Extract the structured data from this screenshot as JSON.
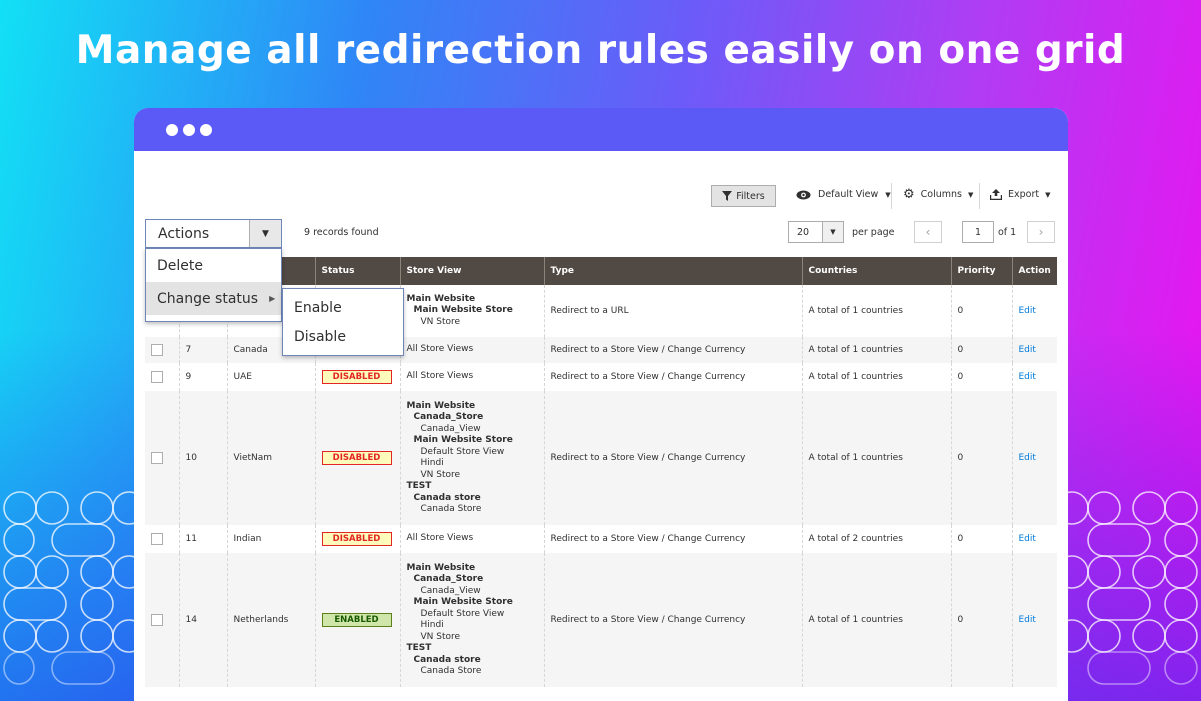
{
  "headline": "Manage all redirection rules easily on one grid",
  "colors": {
    "accent": "#5b5af6",
    "header_bg": "#514943",
    "link": "#007bdb",
    "disabled": "#e22626",
    "enabled": "#185b00"
  },
  "toolbar": {
    "filters_label": "Filters",
    "view_label": "Default View",
    "columns_label": "Columns",
    "export_label": "Export",
    "actions_label": "Actions",
    "records_found": "9 records found",
    "per_page_value": "20",
    "per_page_label": "per page",
    "page_value": "1",
    "page_of": "of 1"
  },
  "actions_menu": {
    "items": [
      "Delete",
      "Change status"
    ],
    "submenu": [
      "Enable",
      "Disable"
    ]
  },
  "grid": {
    "columns": [
      "Status",
      "Store View",
      "Type",
      "Countries",
      "Priority",
      "Action"
    ],
    "rows": [
      {
        "id": "",
        "name": "",
        "status": "",
        "store_view": [
          [
            "l0",
            "Main Website"
          ],
          [
            "l1",
            "Main Website Store"
          ],
          [
            "l2",
            "VN Store"
          ]
        ],
        "type": "Redirect to a URL",
        "countries": "A total of 1 countries",
        "priority": "0",
        "action": "Edit"
      },
      {
        "id": "7",
        "name": "Canada",
        "status": "",
        "store_view": [
          [
            "plain",
            "All Store Views"
          ]
        ],
        "type": "Redirect to a Store View / Change Currency",
        "countries": "A total of 1 countries",
        "priority": "0",
        "action": "Edit"
      },
      {
        "id": "9",
        "name": "UAE",
        "status": "DISABLED",
        "store_view": [
          [
            "plain",
            "All Store Views"
          ]
        ],
        "type": "Redirect to a Store View / Change Currency",
        "countries": "A total of 1 countries",
        "priority": "0",
        "action": "Edit"
      },
      {
        "id": "10",
        "name": "VietNam",
        "status": "DISABLED",
        "store_view": [
          [
            "l0",
            "Main Website"
          ],
          [
            "l1",
            "Canada_Store"
          ],
          [
            "l2",
            "Canada_View"
          ],
          [
            "l1",
            "Main Website Store"
          ],
          [
            "l2",
            "Default Store View"
          ],
          [
            "l2",
            "Hindi"
          ],
          [
            "l2",
            "VN Store"
          ],
          [
            "l0",
            "TEST"
          ],
          [
            "l1",
            "Canada store"
          ],
          [
            "l2",
            "Canada Store"
          ]
        ],
        "type": "Redirect to a Store View / Change Currency",
        "countries": "A total of 1 countries",
        "priority": "0",
        "action": "Edit"
      },
      {
        "id": "11",
        "name": "Indian",
        "status": "DISABLED",
        "store_view": [
          [
            "plain",
            "All Store Views"
          ]
        ],
        "type": "Redirect to a Store View / Change Currency",
        "countries": "A total of 2 countries",
        "priority": "0",
        "action": "Edit"
      },
      {
        "id": "14",
        "name": "Netherlands",
        "status": "ENABLED",
        "store_view": [
          [
            "l0",
            "Main Website"
          ],
          [
            "l1",
            "Canada_Store"
          ],
          [
            "l2",
            "Canada_View"
          ],
          [
            "l1",
            "Main Website Store"
          ],
          [
            "l2",
            "Default Store View"
          ],
          [
            "l2",
            "Hindi"
          ],
          [
            "l2",
            "VN Store"
          ],
          [
            "l0",
            "TEST"
          ],
          [
            "l1",
            "Canada store"
          ],
          [
            "l2",
            "Canada Store"
          ]
        ],
        "type": "Redirect to a Store View / Change Currency",
        "countries": "A total of 1 countries",
        "priority": "0",
        "action": "Edit"
      }
    ]
  }
}
